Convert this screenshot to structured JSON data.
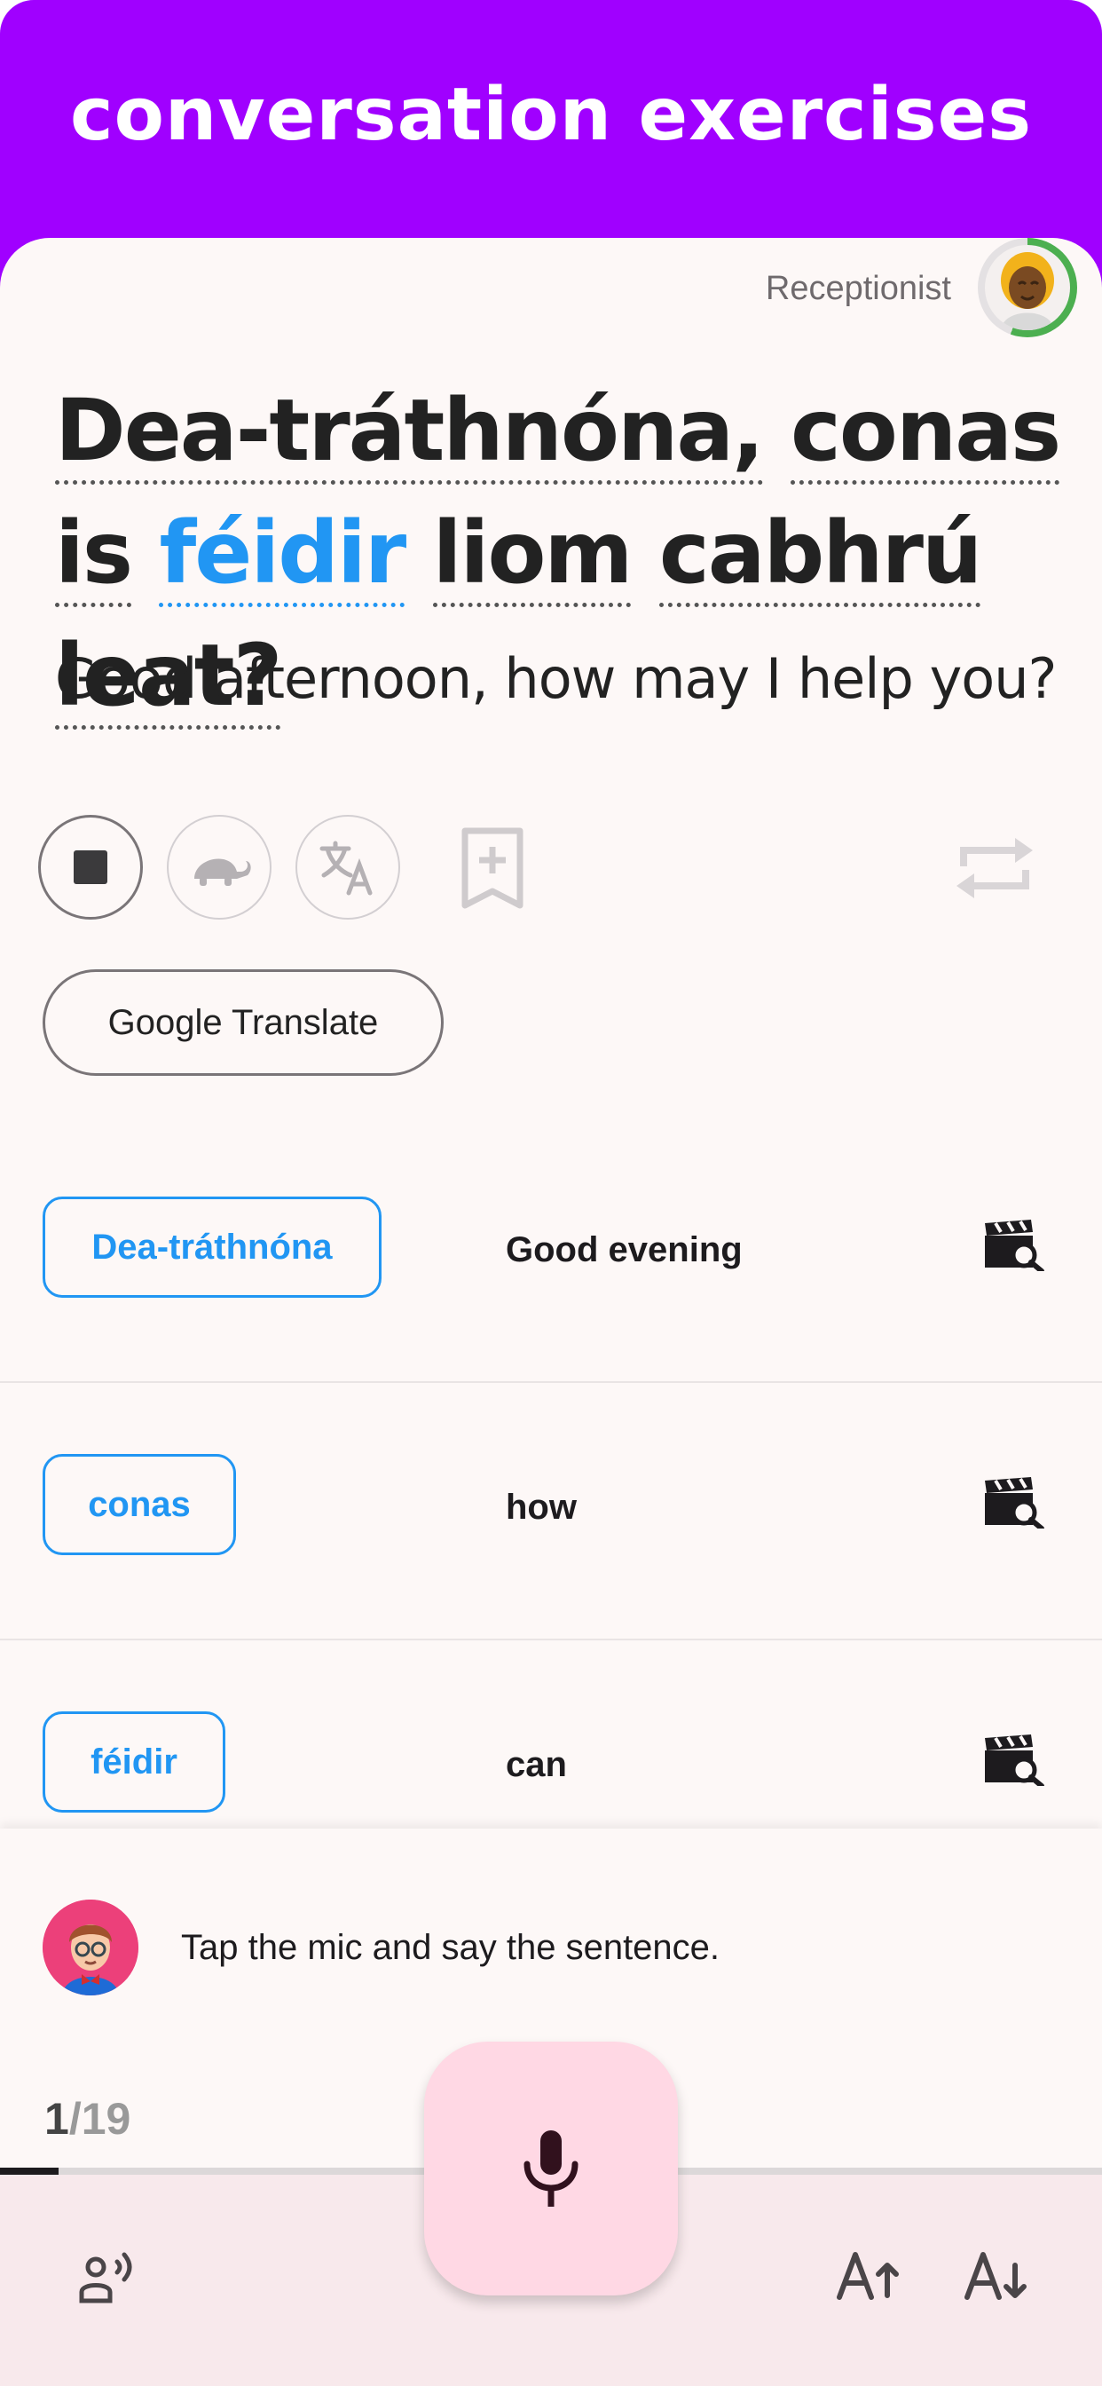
{
  "header": {
    "title": "conversation exercises"
  },
  "speaker": {
    "role": "Receptionist"
  },
  "sentence": {
    "words": [
      "Dea-tráthnóna,",
      "conas",
      "is",
      "féidir",
      "liom",
      "cabhrú",
      "leat?"
    ],
    "translation": "Good afternoon, how may I help you?"
  },
  "actions": {
    "stop": "stop-icon",
    "slow": "turtle-icon",
    "translate": "translate-icon",
    "bookmark": "bookmark-add-icon",
    "repeat": "repeat-icon",
    "google_translate_label": "Google Translate"
  },
  "vocab": [
    {
      "word": "Dea-tráthnóna",
      "meaning": "Good evening"
    },
    {
      "word": "conas",
      "meaning": "how"
    },
    {
      "word": "féidir",
      "meaning": "can"
    }
  ],
  "prompt": {
    "hint": "Tap the mic and say the sentence."
  },
  "progress": {
    "current": "1",
    "total": "/19",
    "fraction": 0.053
  },
  "bottom_bar": {
    "left_icon": "voice-person-icon",
    "mic": "mic-icon",
    "font_up": "font-increase-icon",
    "font_down": "font-decrease-icon"
  },
  "colors": {
    "header": "#a000ff",
    "accent": "#2196f3",
    "fab": "#ffd8e4",
    "ring": "#4caf50"
  }
}
